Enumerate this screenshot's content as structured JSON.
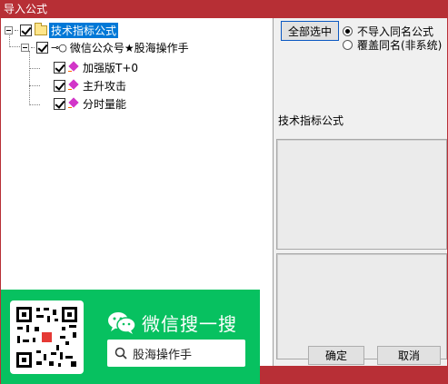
{
  "window": {
    "title": "导入公式"
  },
  "tree": {
    "root": {
      "label": "技术指标公式",
      "checked": true,
      "selected": true
    },
    "group": {
      "label": "微信公众号★股海操作手",
      "checked": true
    },
    "items": [
      {
        "label": "加强版T+0",
        "checked": true
      },
      {
        "label": "主升攻击",
        "checked": true
      },
      {
        "label": "分时量能",
        "checked": true
      }
    ]
  },
  "panel": {
    "select_all_label": "全部选中",
    "options": [
      {
        "label": "不导入同名公式",
        "selected": true
      },
      {
        "label": "覆盖同名(非系统)",
        "selected": false
      }
    ],
    "section_label": "技术指标公式"
  },
  "actions": {
    "ok_label": "确定",
    "cancel_label": "取消"
  },
  "promo": {
    "title": "微信搜一搜",
    "search_text": "股海操作手",
    "brand_color": "#07c160"
  }
}
